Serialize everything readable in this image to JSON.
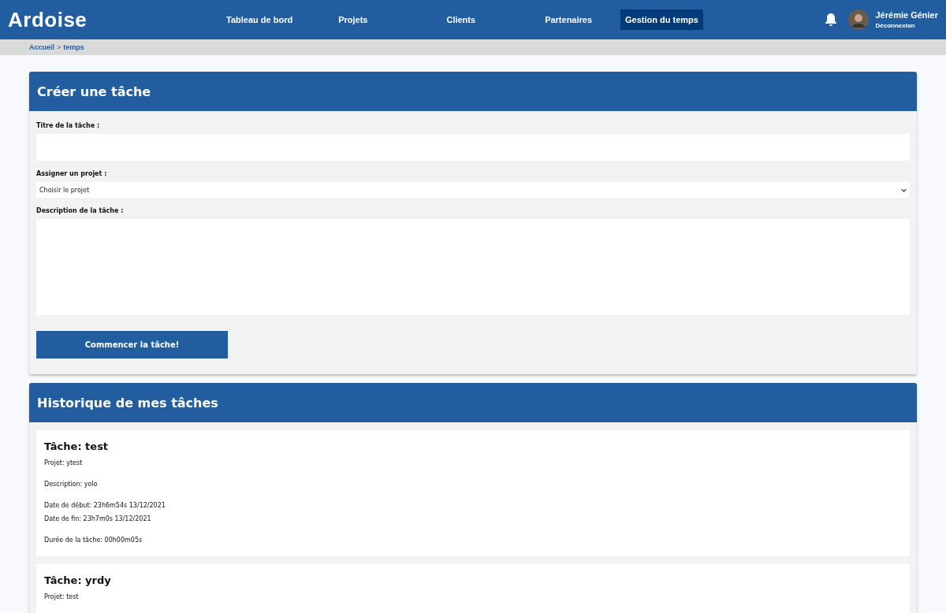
{
  "header": {
    "logo": "Ardoise",
    "nav": [
      {
        "label": "Tableau de bord",
        "selected": false
      },
      {
        "label": "Projets",
        "selected": false
      },
      {
        "label": "Clients",
        "selected": false
      },
      {
        "label": "Partenaires",
        "selected": false
      },
      {
        "label": "Gestion du temps",
        "selected": true
      }
    ],
    "user": {
      "name": "Jérémie Génier",
      "logout": "Déconnexion"
    }
  },
  "breadcrumb": {
    "home": "Accueil",
    "separator": ">",
    "current": "temps"
  },
  "create_panel": {
    "title": "Créer une tâche",
    "title_label": "Titre de la tâche :",
    "project_label": "Assigner un projet :",
    "project_value": "Choisir le projet",
    "description_label": "Description de la tâche :",
    "button": "Commencer la tâche!"
  },
  "history_panel": {
    "title": "Historique de mes tâches",
    "tasks": [
      {
        "title": "Tâche: test",
        "project": "Projet: ytest",
        "description": "Description: yolo",
        "start": "Date de début: 23h6m54s 13/12/2021",
        "end": "Date de fin: 23h7m0s 13/12/2021",
        "duration": "Durée de la tâche: 00h00m05s"
      },
      {
        "title": "Tâche: yrdy",
        "project": "Projet: test"
      }
    ]
  }
}
